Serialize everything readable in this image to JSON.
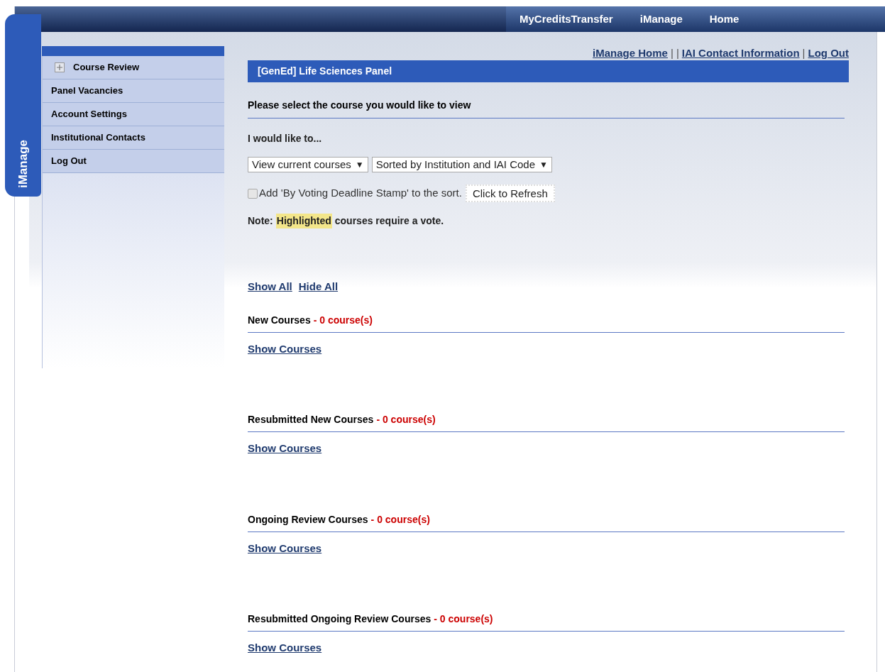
{
  "top_nav": [
    {
      "label": "MyCreditsTransfer"
    },
    {
      "label": "iManage"
    },
    {
      "label": "Home"
    }
  ],
  "side_tab": "iManage",
  "sidebar": {
    "items": [
      {
        "label": "Course Review",
        "kind": "expandable",
        "expanded": false
      },
      {
        "label": "Panel Vacancies",
        "kind": "plain"
      },
      {
        "label": "Account Settings",
        "kind": "plain"
      },
      {
        "label": "Institutional Contacts",
        "kind": "plain"
      },
      {
        "label": "Log Out",
        "kind": "plain"
      }
    ]
  },
  "top_links": [
    {
      "kind": "link",
      "label": "iManage Home"
    },
    {
      "kind": "separator",
      "label": "|"
    },
    {
      "kind": "separator",
      "label": "|"
    },
    {
      "kind": "link",
      "label": "IAI Contact Information"
    },
    {
      "kind": "separator",
      "label": "|"
    },
    {
      "kind": "link",
      "label": "Log Out"
    }
  ],
  "panel_title": "[GenEd] Life Sciences Panel",
  "heading": "Please select the course you would like to view",
  "prompt": "I would like to...",
  "dropdowns": [
    {
      "value": "View current courses"
    },
    {
      "value": "Sorted by Institution and IAI Code"
    }
  ],
  "dropdown_arrow": "▼",
  "sort_option": {
    "label": "Add 'By Voting Deadline Stamp' to the sort.",
    "checked": false
  },
  "refresh_button": "Click to Refresh",
  "note": {
    "prefix": "Note:",
    "highlight": "Highlighted",
    "suffix": "courses require a vote."
  },
  "toggle_links": [
    "Show All",
    "Hide All"
  ],
  "sections": [
    {
      "title": "New Courses",
      "count": "- 0 course(s)",
      "link": "Show Courses"
    },
    {
      "title": "Resubmitted New Courses",
      "count": "- 0 course(s)",
      "link": "Show Courses"
    },
    {
      "title": "Ongoing Review Courses",
      "count": "- 0 course(s)",
      "link": "Show Courses"
    },
    {
      "title": "Resubmitted Ongoing Review Courses",
      "count": "- 0 course(s)",
      "link": "Show Courses"
    }
  ]
}
